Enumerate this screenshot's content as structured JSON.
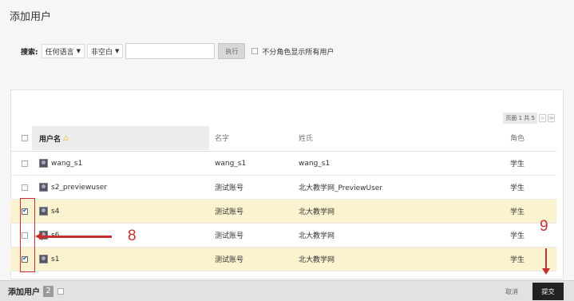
{
  "page_title": "添加用户",
  "search": {
    "label": "搜索:",
    "lang_select": "任何语言",
    "filter_select": "非空白",
    "input_value": "",
    "execute_label": "执行",
    "show_all_label": "不分角色显示所有用户"
  },
  "pager": {
    "text": "页面 1 共 5",
    "next": ">",
    "last": "≫"
  },
  "table": {
    "headers": {
      "username": "用户名",
      "first_name": "名字",
      "last_name": "姓氏",
      "role": "角色"
    },
    "rows": [
      {
        "username": "wang_s1",
        "first_name": "wang_s1",
        "last_name": "wang_s1",
        "role": "学生",
        "checked": false,
        "highlighted": false
      },
      {
        "username": "s2_previewuser",
        "first_name": "测试账号",
        "last_name": "北大教学网_PreviewUser",
        "role": "学生",
        "checked": false,
        "highlighted": false
      },
      {
        "username": "s4",
        "first_name": "测试账号",
        "last_name": "北大教学网",
        "role": "学生",
        "checked": true,
        "highlighted": true
      },
      {
        "username": "s6",
        "first_name": "测试账号",
        "last_name": "北大教学网",
        "role": "学生",
        "checked": false,
        "highlighted": false
      },
      {
        "username": "s1",
        "first_name": "测试账号",
        "last_name": "北大教学网",
        "role": "学生",
        "checked": true,
        "highlighted": true
      }
    ]
  },
  "annotations": {
    "step_8": "8",
    "step_9": "9",
    "color": "#c62f2f"
  },
  "bottom_bar": {
    "label": "添加用户",
    "count": "2",
    "cancel_label": "取消",
    "submit_label": "提交"
  }
}
